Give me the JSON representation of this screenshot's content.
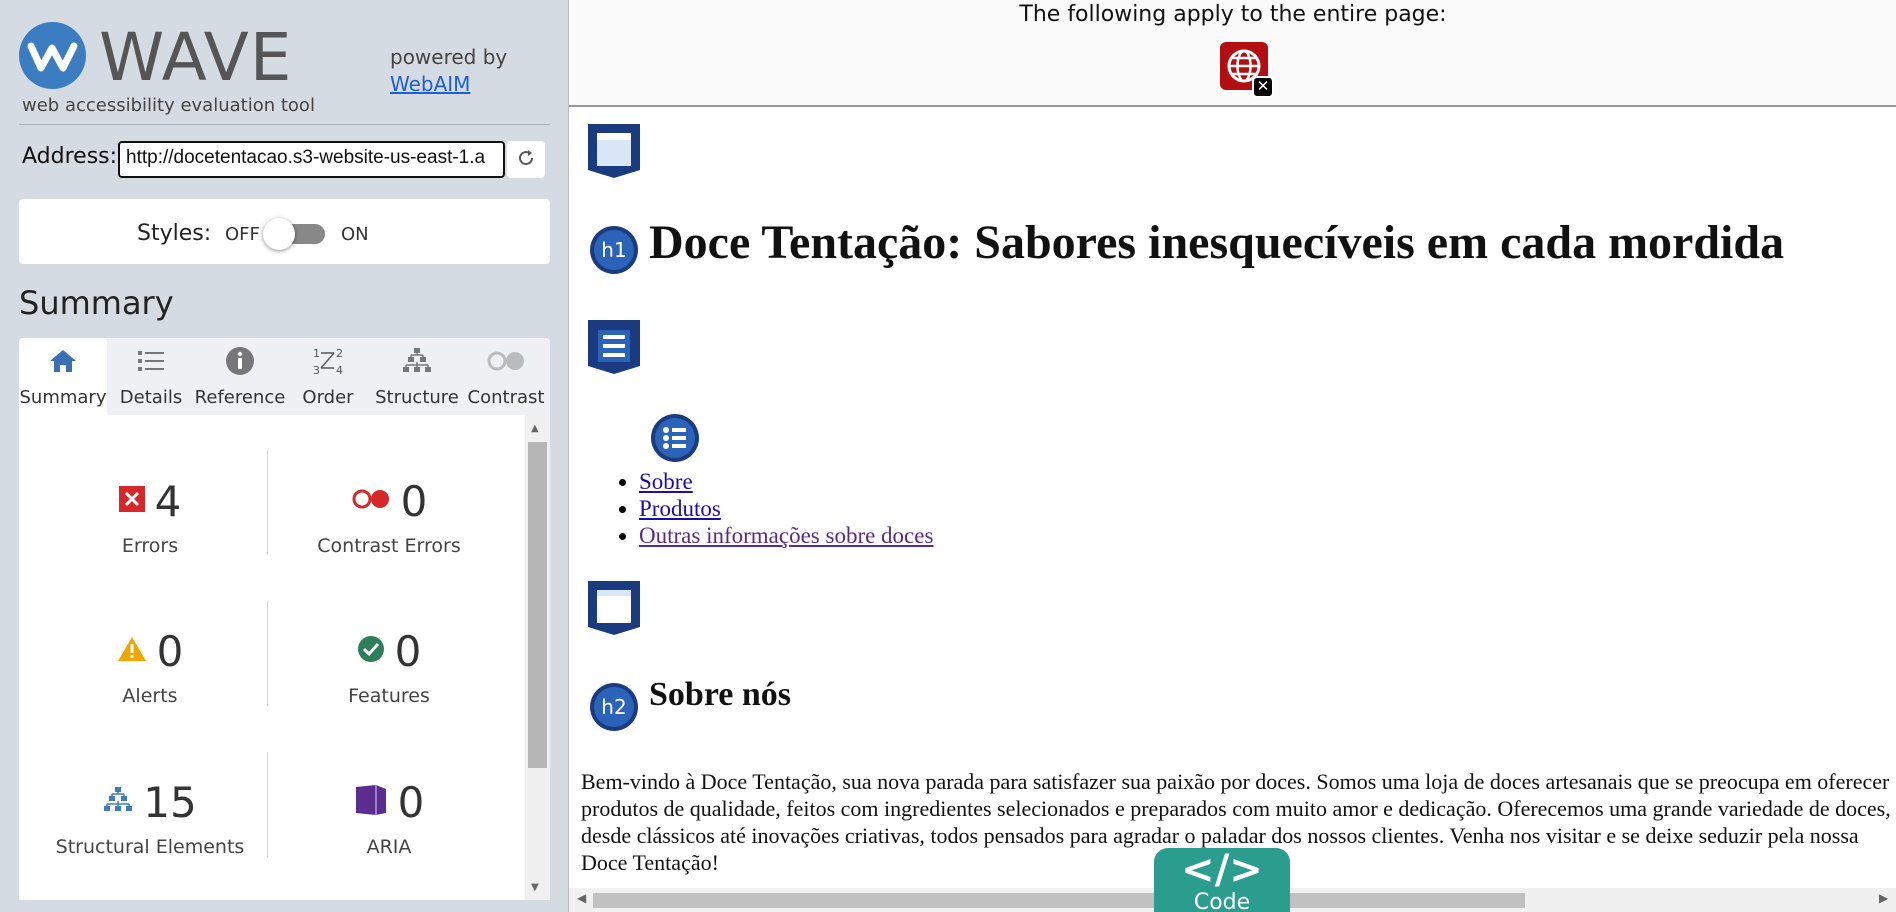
{
  "app": {
    "name": "WAVE",
    "tagline": "web accessibility evaluation tool",
    "powered_by": "powered by",
    "webaim_link": "WebAIM"
  },
  "address": {
    "label": "Address:",
    "value": "http://docetentacao.s3-website-us-east-1.a"
  },
  "styles": {
    "label": "Styles:",
    "off": "OFF",
    "on": "ON",
    "enabled": false
  },
  "summary_heading": "Summary",
  "tabs": [
    {
      "label": "Summary",
      "icon": "home-icon",
      "active": true
    },
    {
      "label": "Details",
      "icon": "list-icon"
    },
    {
      "label": "Reference",
      "icon": "info-icon"
    },
    {
      "label": "Order",
      "icon": "order-icon"
    },
    {
      "label": "Structure",
      "icon": "structure-icon"
    },
    {
      "label": "Contrast",
      "icon": "contrast-icon"
    }
  ],
  "stats": {
    "errors": {
      "count": "4",
      "label": "Errors",
      "color": "#d62828"
    },
    "contrast_errors": {
      "count": "0",
      "label": "Contrast Errors",
      "color": "#d62828"
    },
    "alerts": {
      "count": "0",
      "label": "Alerts",
      "color": "#f0a500"
    },
    "features": {
      "count": "0",
      "label": "Features",
      "color": "#2e8b57"
    },
    "structural": {
      "count": "15",
      "label": "Structural Elements",
      "color": "#3c7dc2"
    },
    "aria": {
      "count": "0",
      "label": "ARIA",
      "color": "#5b2d8e"
    }
  },
  "page": {
    "apply_text": "The following apply to the entire page:",
    "h1": "Doce Tentação: Sabores inesquecíveis em cada mordida",
    "h1_badge": "h1",
    "nav_links": [
      "Sobre",
      "Produtos",
      "Outras informações sobre doces"
    ],
    "h2": "Sobre nós",
    "h2_badge": "h2",
    "paragraph": "Bem-vindo à Doce Tentação, sua nova parada para satisfazer sua paixão por doces. Somos uma loja de doces artesanais que se preocupa em oferecer produtos de qualidade, feitos com ingredientes selecionados e preparados com muito amor e dedicação. Oferecemos uma grande variedade de doces, desde clássicos até inovações criativas, todos pensados para agradar o paladar dos nossos clientes. Venha nos visitar e se deixe seduzir pela nossa Doce Tentação!"
  },
  "code_button": {
    "symbol": "</>",
    "label": "Code"
  },
  "colors": {
    "wave_blue": "#3c7dc2",
    "landmark_navy": "#1b3b80",
    "code_teal": "#2a9d8f",
    "error_red": "#b30f12"
  }
}
